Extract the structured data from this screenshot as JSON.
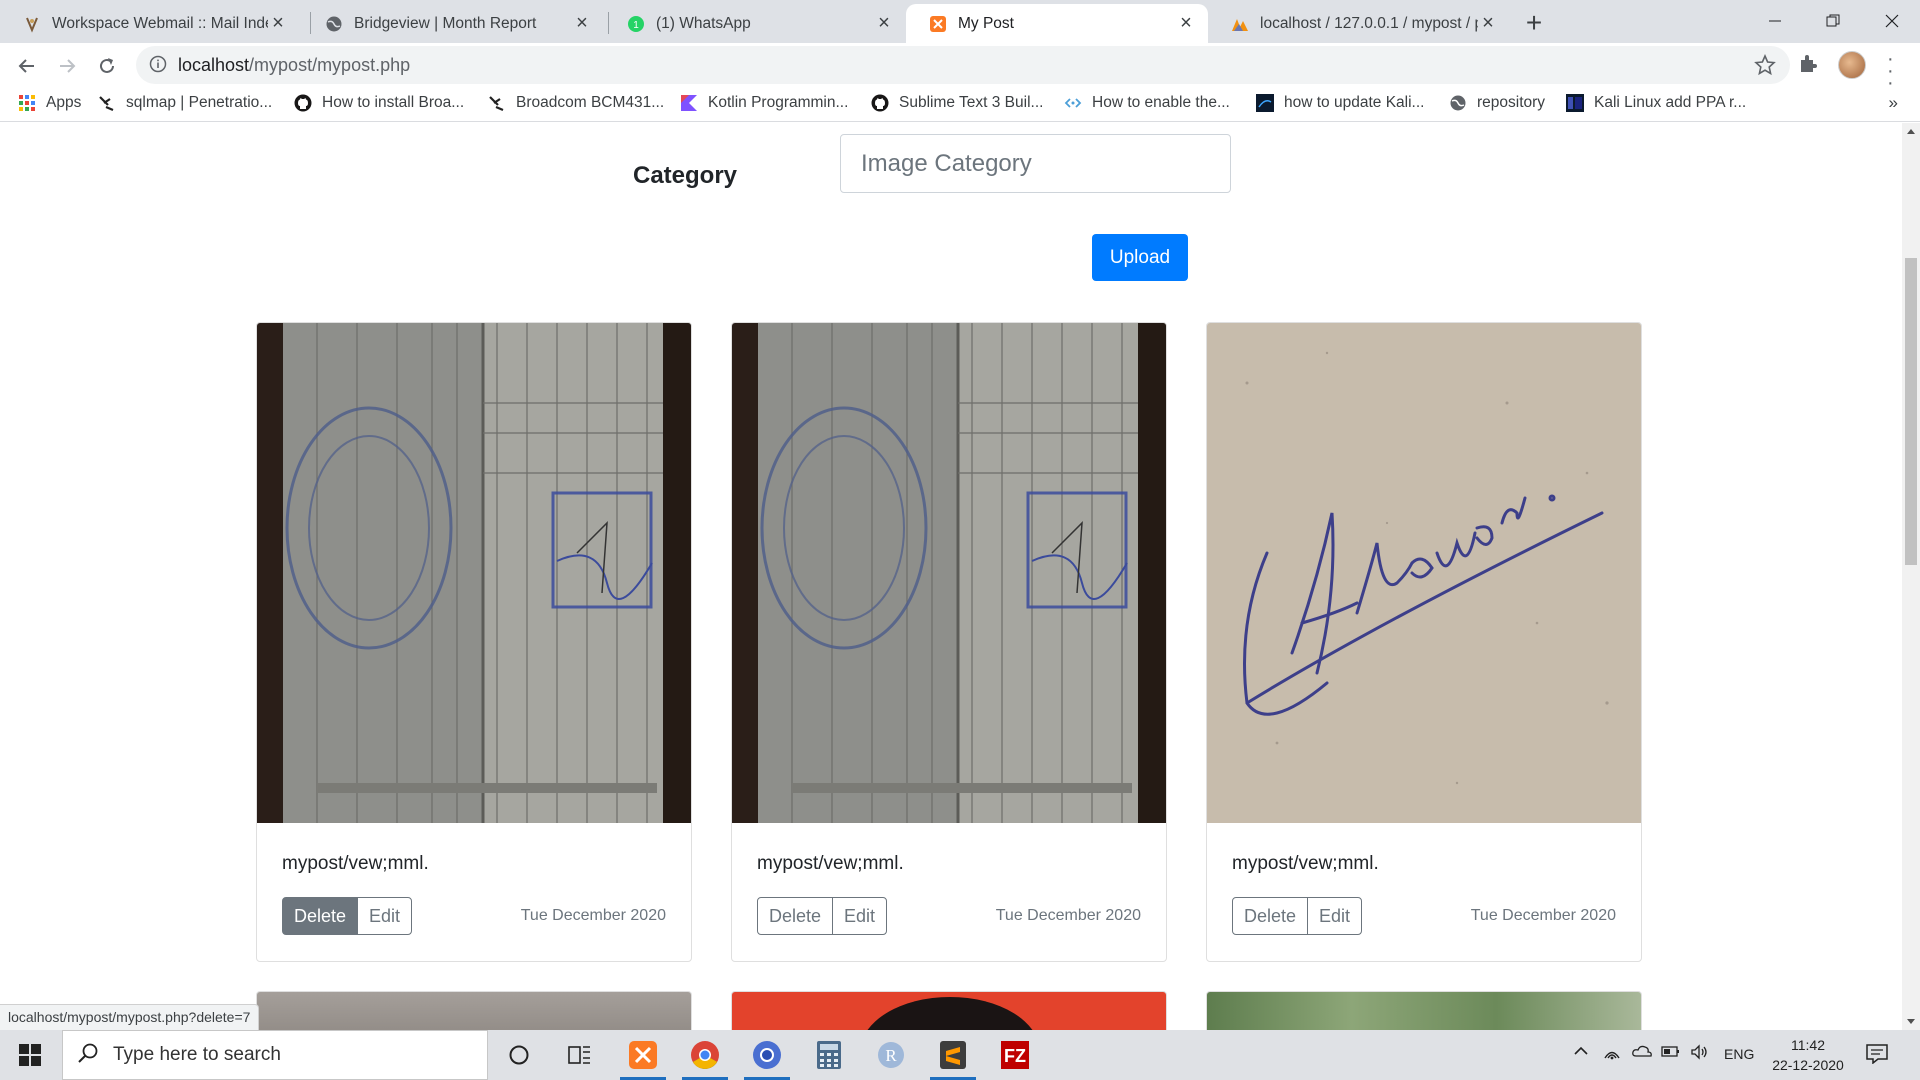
{
  "browser": {
    "tabs": [
      {
        "title": "Workspace Webmail :: Mail Index",
        "icon": "webmail-icon"
      },
      {
        "title": "Bridgeview | Month Report",
        "icon": "globe-icon"
      },
      {
        "title": "(1) WhatsApp",
        "icon": "whatsapp-icon"
      },
      {
        "title": "My Post",
        "icon": "xampp-icon",
        "active": true
      },
      {
        "title": "localhost / 127.0.0.1 / mypost / p",
        "icon": "phpmyadmin-icon"
      }
    ],
    "url_host": "localhost",
    "url_path": "/mypost/mypost.php",
    "bookmarks": [
      {
        "label": "Apps",
        "icon": "apps-grid-icon"
      },
      {
        "label": "sqlmap | Penetratio...",
        "icon": "sqlmap-icon"
      },
      {
        "label": "How to install Broa...",
        "icon": "github-icon"
      },
      {
        "label": "Broadcom BCM431...",
        "icon": "sqlmap-icon"
      },
      {
        "label": "Kotlin Programmin...",
        "icon": "kotlin-icon"
      },
      {
        "label": "Sublime Text 3 Buil...",
        "icon": "github-icon"
      },
      {
        "label": "How to enable the...",
        "icon": "code-icon"
      },
      {
        "label": "how to update Kali...",
        "icon": "kali-icon"
      },
      {
        "label": "repository",
        "icon": "globe-icon"
      },
      {
        "label": "Kali Linux add PPA r...",
        "icon": "kali-icon"
      }
    ],
    "bookmarks_more": "»"
  },
  "page": {
    "category_label": "Category",
    "category_placeholder": "Image Category",
    "upload_label": "Upload",
    "posts": [
      {
        "title": "mypost/vew;mml.",
        "delete_label": "Delete",
        "edit_label": "Edit",
        "date": "Tue December 2020",
        "image": "document-stamp-photo"
      },
      {
        "title": "mypost/vew;mml.",
        "delete_label": "Delete",
        "edit_label": "Edit",
        "date": "Tue December 2020",
        "image": "document-stamp-photo"
      },
      {
        "title": "mypost/vew;mml.",
        "delete_label": "Delete",
        "edit_label": "Edit",
        "date": "Tue December 2020",
        "image": "signature-photo"
      }
    ]
  },
  "status_url": "localhost/mypost/mypost.php?delete=7",
  "taskbar": {
    "search_placeholder": "Type here to search",
    "language": "ENG",
    "time": "11:42",
    "date": "22-12-2020"
  }
}
